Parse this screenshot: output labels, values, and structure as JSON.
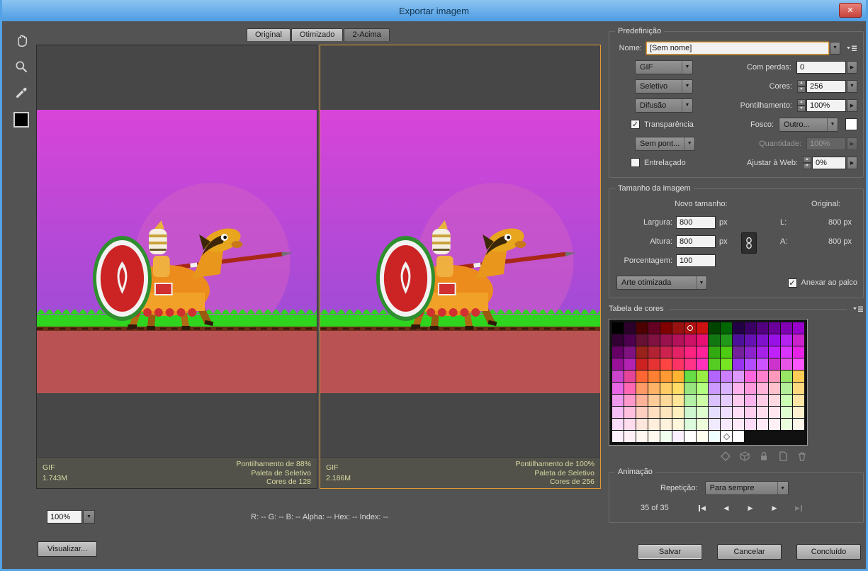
{
  "window": {
    "title": "Exportar imagem",
    "close": "✕"
  },
  "tabs": [
    {
      "label": "Original"
    },
    {
      "label": "Otimizado"
    },
    {
      "label": "2-Acima"
    }
  ],
  "previews": [
    {
      "format": "GIF",
      "size": "1.743M",
      "lines": [
        "Pontilhamento de 88%",
        "Paleta de Seletivo",
        "Cores de 128"
      ]
    },
    {
      "format": "GIF",
      "size": "2.186M",
      "lines": [
        "Pontilhamento de 100%",
        "Paleta de Seletivo",
        "Cores de 256"
      ]
    }
  ],
  "statusbar": {
    "zoom": "100%",
    "channels": "R: --   G: --   B: --   Alpha: --   Hex: --   Index: --",
    "preview_button": "Visualizar..."
  },
  "preset": {
    "legend": "Predefinição",
    "nome_label": "Nome:",
    "nome_value": "[Sem nome]",
    "format": "GIF",
    "com_perdas_label": "Com perdas:",
    "com_perdas": "0",
    "reduction": "Seletivo",
    "cores_label": "Cores:",
    "cores": "256",
    "dither": "Difusão",
    "pont_label": "Pontilhamento:",
    "pont": "100%",
    "transparencia": "Transparência",
    "fosco_label": "Fosco:",
    "fosco": "Outro...",
    "sem_pont": "Sem pont...",
    "quant_label": "Quantidade:",
    "quant": "100%",
    "entrelacado": "Entrelaçado",
    "ajustar_label": "Ajustar à Web:",
    "ajustar": "0%"
  },
  "size": {
    "legend": "Tamanho da imagem",
    "novo": "Novo tamanho:",
    "original": "Original:",
    "largura_label": "Largura:",
    "largura": "800",
    "px": "px",
    "l_label": "L:",
    "l_value": "800 px",
    "altura_label": "Altura:",
    "altura": "800",
    "a_label": "A:",
    "a_value": "800 px",
    "pct_label": "Porcentagem:",
    "pct": "100",
    "arte": "Arte otimizada",
    "anexar": "Anexar ao palco"
  },
  "color_table": {
    "legend": "Tabela de cores",
    "selected": {
      "row": 0,
      "col": 6
    },
    "transparent": {
      "row": 9,
      "col": 9
    },
    "rows": [
      [
        "#000000",
        "#2b002b",
        "#4c0000",
        "#660022",
        "#800000",
        "#991111",
        "#b31111",
        "#cc1111",
        "#004400",
        "#006600",
        "#220044",
        "#3a0066",
        "#520080",
        "#6a0099",
        "#8200b3",
        "#9900cc"
      ],
      [
        "#330033",
        "#4d004d",
        "#661133",
        "#801140",
        "#99114d",
        "#b3115a",
        "#cc1166",
        "#e61173",
        "#117711",
        "#22991a",
        "#4d1199",
        "#6611b3",
        "#8011cc",
        "#9911e6",
        "#b322ee",
        "#cc22cc"
      ],
      [
        "#660066",
        "#801180",
        "#99221a",
        "#b32233",
        "#cc224d",
        "#e62266",
        "#ff2280",
        "#ff2299",
        "#33aa11",
        "#4dcc11",
        "#732299",
        "#8c22cc",
        "#a622e6",
        "#bf22ff",
        "#d933ff",
        "#e622e6"
      ],
      [
        "#991199",
        "#b322b3",
        "#cc2222",
        "#e63333",
        "#ff4444",
        "#ff3366",
        "#ff3388",
        "#ff33bb",
        "#55cc22",
        "#77e622",
        "#9933ee",
        "#b34dff",
        "#cc55ff",
        "#cc33cc",
        "#e655e6",
        "#ff55ff"
      ],
      [
        "#cc44cc",
        "#e64499",
        "#ff6633",
        "#ff8033",
        "#ff9933",
        "#ffb333",
        "#66dd44",
        "#99ee44",
        "#b366ff",
        "#cc80ff",
        "#dd99ff",
        "#ff66dd",
        "#ff80cc",
        "#ff99bb",
        "#99e666",
        "#ffcc55"
      ],
      [
        "#e666e6",
        "#ff66b3",
        "#ff9966",
        "#ffb366",
        "#ffcc66",
        "#ffdd66",
        "#99e680",
        "#b3ff80",
        "#cc99ff",
        "#d9b3ff",
        "#ffb3ee",
        "#ff99dd",
        "#ffb3d9",
        "#ffc2cc",
        "#b3ee99",
        "#ffd980"
      ],
      [
        "#ee99ee",
        "#ff99cc",
        "#ffb399",
        "#ffcc99",
        "#ffd999",
        "#ffe699",
        "#b3f2a6",
        "#ccffa6",
        "#d9c2ff",
        "#e6ccff",
        "#ffccee",
        "#ffb3ee",
        "#ffcce6",
        "#ffd9e0",
        "#ccffb3",
        "#ffe6a6"
      ],
      [
        "#f7bff7",
        "#ffbfdf",
        "#ffcfbf",
        "#ffdfbf",
        "#ffe6bf",
        "#fff0bf",
        "#cff7cf",
        "#dfffcf",
        "#e6dfff",
        "#f0dfff",
        "#ffdff7",
        "#ffcff0",
        "#ffdfef",
        "#ffe6ef",
        "#dfffd0",
        "#fff0cf"
      ],
      [
        "#fadcfa",
        "#ffdcee",
        "#ffe6dc",
        "#ffeedc",
        "#fff2dc",
        "#fff7dc",
        "#dcfadc",
        "#eeffdc",
        "#f0eaff",
        "#f7eaff",
        "#ffeafa",
        "#ffdcf7",
        "#ffeaf7",
        "#fff0f5",
        "#eaffdc",
        "#fff7ea"
      ],
      [
        "#fdf0fd",
        "#fff0f7",
        "#fff7f0",
        "#fffaf0",
        "#f0fff0",
        "#faf0ff",
        "#ffffff",
        "#fffff0",
        "#f0ffff",
        "#ffffff",
        "#ffffff"
      ]
    ]
  },
  "animation": {
    "legend": "Animação",
    "rep_label": "Repetição:",
    "rep": "Para sempre",
    "frames": "35 of 35"
  },
  "footer": {
    "salvar": "Salvar",
    "cancelar": "Cancelar",
    "concluido": "Concluído"
  }
}
